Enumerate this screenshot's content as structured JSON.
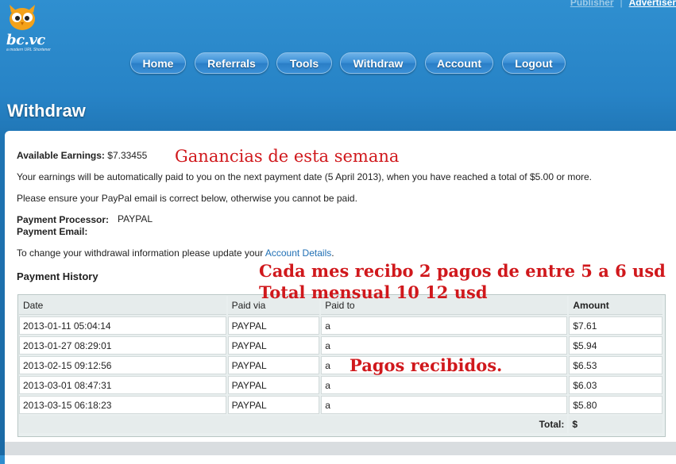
{
  "logo": {
    "text": "bc.vc",
    "tagline": "a modern URL Shortener"
  },
  "toplinks": {
    "publisher": "Publisher",
    "separator": "|",
    "advertiser": "Advertiser"
  },
  "nav": [
    {
      "label": "Home"
    },
    {
      "label": "Referrals"
    },
    {
      "label": "Tools"
    },
    {
      "label": "Withdraw"
    },
    {
      "label": "Account"
    },
    {
      "label": "Logout"
    }
  ],
  "page": {
    "title": "Withdraw"
  },
  "earnings": {
    "label": "Available Earnings:",
    "value": "$7.33455",
    "auto_paid_text": "Your earnings will be automatically paid to you on the next payment date (5 April 2013), when you have reached a total of $5.00 or more.",
    "paypal_notice": "Please ensure your PayPal email is correct below, otherwise you cannot be paid."
  },
  "payment": {
    "processor_label": "Payment Processor:",
    "processor_value": "PAYPAL",
    "email_label": "Payment Email:",
    "email_value": "",
    "change_text": "To change your withdrawal information please update your",
    "account_link": "Account Details",
    "period": "."
  },
  "history": {
    "title": "Payment History",
    "columns": [
      "Date",
      "Paid via",
      "Paid to",
      "Amount"
    ],
    "rows": [
      {
        "date": "2013-01-11 05:04:14",
        "via": "PAYPAL",
        "to": "a",
        "amount": "$7.61"
      },
      {
        "date": "2013-01-27 08:29:01",
        "via": "PAYPAL",
        "to": "a",
        "amount": "$5.94"
      },
      {
        "date": "2013-02-15 09:12:56",
        "via": "PAYPAL",
        "to": "a",
        "amount": "$6.53"
      },
      {
        "date": "2013-03-01 08:47:31",
        "via": "PAYPAL",
        "to": "a",
        "amount": "$6.03"
      },
      {
        "date": "2013-03-15 06:18:23",
        "via": "PAYPAL",
        "to": "a",
        "amount": "$5.80"
      }
    ],
    "total_label": "Total:",
    "total_value": "$"
  },
  "annotations": {
    "weekly": "Ganancias de  esta semana",
    "monthly_1": "Cada mes recibo 2 pagos de entre 5 a 6 usd",
    "monthly_2": "Total mensual 10 12 usd",
    "received": "Pagos recibidos."
  },
  "colors": {
    "annotation": "#d0181c",
    "link": "#1f6fb4",
    "background": "#2783c6"
  }
}
